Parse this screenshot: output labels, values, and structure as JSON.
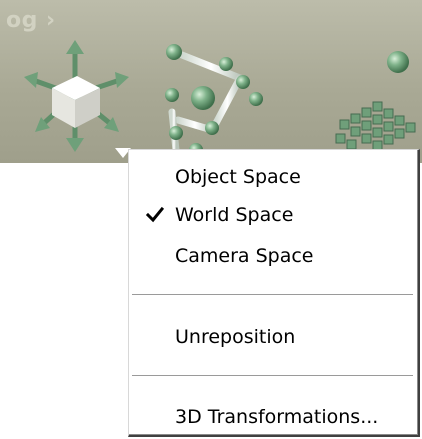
{
  "viewport": {
    "title": "og ›"
  },
  "menu": {
    "items": [
      {
        "label": "Object Space",
        "checked": false
      },
      {
        "label": "World Space",
        "checked": true,
        "check_icon": "checkmark-icon"
      },
      {
        "label": "Camera Space",
        "checked": false
      },
      {
        "label": "Unreposition",
        "checked": false
      },
      {
        "label": "3D Transformations...",
        "checked": false
      }
    ]
  },
  "colors": {
    "viewport_bg": "#a9a995",
    "menu_bg": "#ffffff",
    "menu_text": "#000000",
    "gizmo_green": "#6fa07a"
  }
}
